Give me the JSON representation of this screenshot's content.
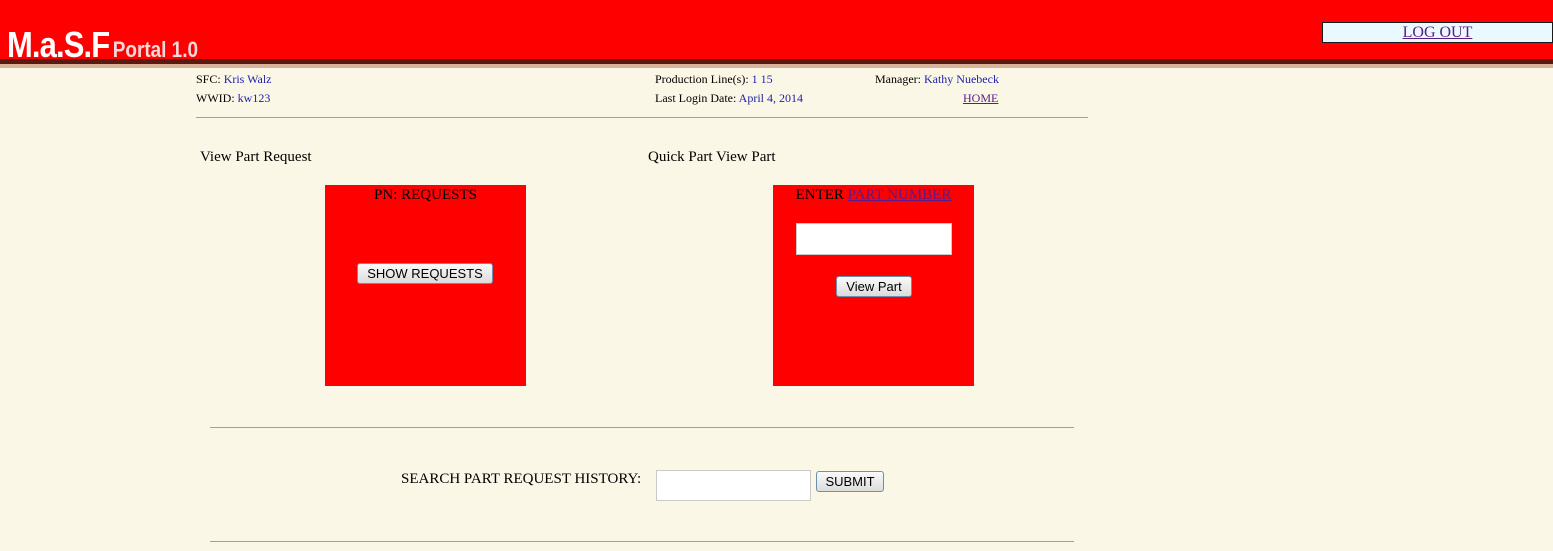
{
  "header": {
    "logo_main": "M.a.S.F",
    "logo_sub": "Portal 1.0",
    "logout_label": "LOG OUT",
    "bg_color": "#ff0000"
  },
  "user_info": {
    "sfc_label": "SFC:",
    "sfc_value": "Kris Walz",
    "wwid_label": "WWID:",
    "wwid_value": "kw123",
    "production_lines_label": "Production Line(s):",
    "production_lines_value": "1 15",
    "last_login_label": "Last Login Date:",
    "last_login_value": "April 4, 2014",
    "manager_label": "Manager:",
    "manager_value": "Kathy Nuebeck",
    "home_label": "HOME"
  },
  "view_part_request": {
    "title": "View Part Request",
    "box_heading": "PN: REQUESTS",
    "button_label": "SHOW REQUESTS"
  },
  "quick_part_view": {
    "title": "Quick Part View Part",
    "box_heading_prefix": "ENTER",
    "box_heading_link": "PART NUMBER",
    "input_value": "",
    "button_label": "View Part"
  },
  "search": {
    "label": "SEARCH PART REQUEST HISTORY:",
    "input_value": "",
    "submit_label": "SUBMIT"
  }
}
